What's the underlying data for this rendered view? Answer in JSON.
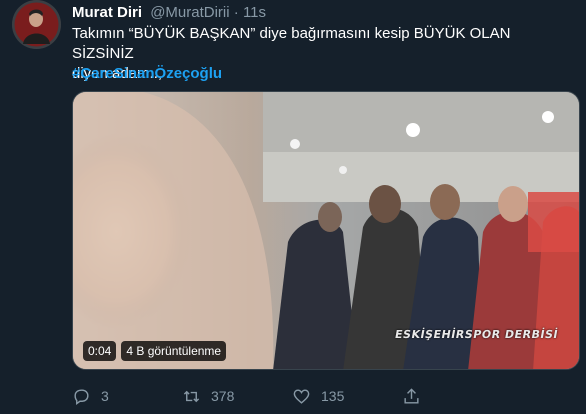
{
  "tweet": {
    "author": {
      "display_name": "Murat Diri",
      "handle": "@MuratDirii",
      "separator": "·",
      "time": "11s"
    },
    "text_line1": "Takımın “BÜYÜK BAŞKAN” diye bağırmasını kesip BÜYÜK OLAN SİZSİNİZ",
    "text_line2": "diyen adam..,",
    "hashtag": "#ÇareSinanÖzeçoğlu",
    "media": {
      "duration": "0:04",
      "views": "4 B görüntülenme",
      "overlay_caption": "ESKİŞEHİRSPOR DERBİSİ"
    },
    "actions": {
      "reply_count": "3",
      "retweet_count": "378",
      "like_count": "135"
    }
  },
  "colors": {
    "background": "#15202b",
    "text": "#ffffff",
    "muted": "#8899a6",
    "link": "#1da1f2",
    "border": "#38444d"
  },
  "icons": [
    "reply-icon",
    "retweet-icon",
    "like-icon",
    "share-icon"
  ]
}
